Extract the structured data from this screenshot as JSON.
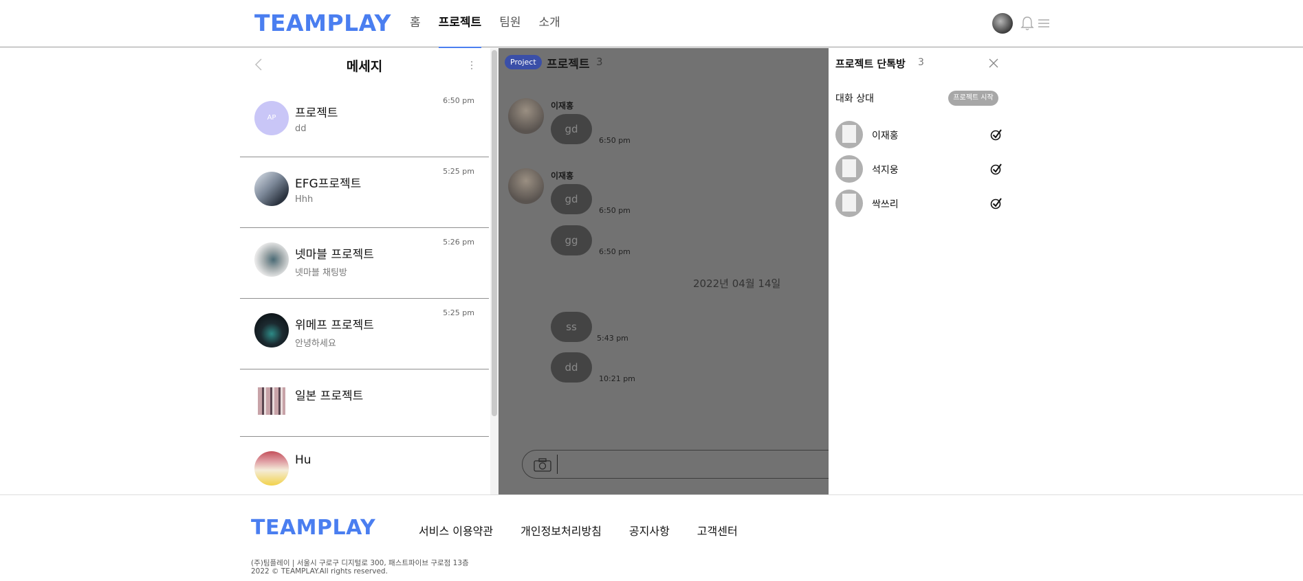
{
  "header": {
    "logo": "TEAMPLAY",
    "nav": [
      "홈",
      "프로젝트",
      "팀원",
      "소개"
    ],
    "active_nav": "프로젝트"
  },
  "sidebar": {
    "title": "메세지",
    "chats": [
      {
        "name": "프로젝트",
        "sub": "dd",
        "time": "6:50 pm",
        "avatar_text": "AP",
        "avatar_color": "#c9c6f7"
      },
      {
        "name": "EFG프로젝트",
        "sub": "Hhh",
        "time": "5:25 pm"
      },
      {
        "name": "넷마블 프로젝트",
        "sub": "넷마블 채팅방",
        "time": "5:26 pm"
      },
      {
        "name": "위메프 프로젝트",
        "sub": "안녕하세요",
        "time": "5:25 pm"
      },
      {
        "name": "일본 프로젝트",
        "sub": "",
        "time": ""
      },
      {
        "name": "Hu",
        "sub": "",
        "time": ""
      }
    ]
  },
  "chat": {
    "badge": "Project",
    "title": "프로젝트",
    "count": "3",
    "messages": [
      {
        "sender": "이재홍",
        "text": "gd",
        "time": "6:50 pm"
      },
      {
        "sender": "이재홍",
        "text": "gd",
        "time": "6:50 pm"
      },
      {
        "sender": "",
        "text": "gg",
        "time": "6:50 pm"
      },
      {
        "sender": "",
        "text": "ss",
        "time": "5:43 pm"
      },
      {
        "sender": "",
        "text": "dd",
        "time": "10:21 pm"
      }
    ],
    "date_separator": "2022년 04월 14일",
    "input_placeholder": ""
  },
  "panel": {
    "title": "프로젝트 단톡방",
    "count": "3",
    "partner_label": "대화 상대",
    "start_button": "프로젝트 시작",
    "members": [
      "이재홍",
      "석지웅",
      "싹쓰리"
    ]
  },
  "footer": {
    "logo": "TEAMPLAY",
    "links": [
      "서비스 이용약관",
      "개인정보처리방침",
      "공지사항",
      "고객센터"
    ],
    "address": "(주)팀플레이 | 서울시 구로구 디지털로 300, 패스트파이브 구로점 13층",
    "copyright": "2022 © TEAMPLAY.All rights reserved."
  },
  "colors": {
    "brand": "#4a7ef0",
    "overlay": "#727272",
    "badge": "#3a4fa8"
  }
}
